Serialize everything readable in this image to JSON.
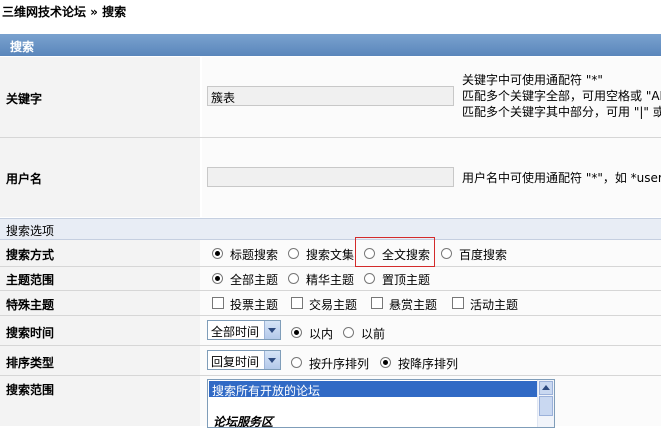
{
  "breadcrumb": "三维网技术论坛 » 搜索",
  "panel_title": "搜索",
  "keyword": {
    "label": "关键字",
    "value": "簇表",
    "hint1": "关键字中可使用通配符 \"*\"",
    "hint2": "匹配多个关键字全部，可用空格或 \"AND\"",
    "hint3": "匹配多个关键字其中部分，可用 \"|\" 或"
  },
  "username": {
    "label": "用户名",
    "value": "",
    "hint": "用户名中可使用通配符 \"*\"，如 *user"
  },
  "options_header": "搜索选项",
  "search_mode": {
    "label": "搜索方式",
    "options": [
      "标题搜索",
      "搜索文集",
      "全文搜索",
      "百度搜索"
    ]
  },
  "topic_scope": {
    "label": "主题范围",
    "options": [
      "全部主题",
      "精华主题",
      "置顶主题"
    ]
  },
  "special_topics": {
    "label": "特殊主题",
    "options": [
      "投票主题",
      "交易主题",
      "悬赏主题",
      "活动主题"
    ]
  },
  "search_time": {
    "label": "搜索时间",
    "select_value": "全部时间",
    "options": [
      "以内",
      "以前"
    ]
  },
  "sort_type": {
    "label": "排序类型",
    "select_value": "回复时间",
    "options": [
      "按升序排列",
      "按降序排列"
    ]
  },
  "search_range": {
    "label": "搜索范围",
    "selected_item": "搜索所有开放的论坛",
    "group_item": "论坛服务区"
  }
}
